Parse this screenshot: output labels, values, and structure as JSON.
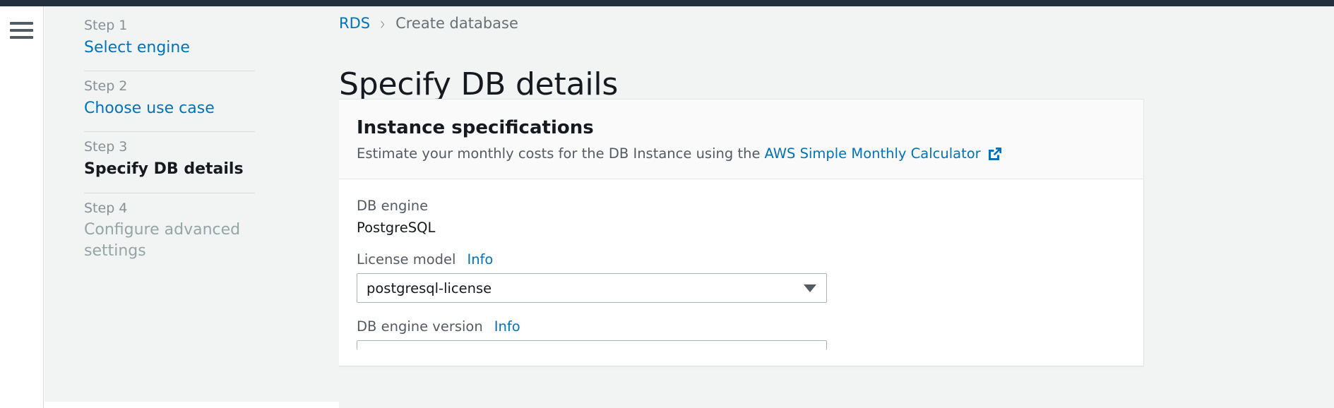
{
  "colors": {
    "topbar": "#232f3e",
    "link": "#0073bb",
    "muted": "#879196",
    "text": "#16191f",
    "panel_bg": "#ffffff",
    "page_bg": "#f2f3f3"
  },
  "nav": {
    "menu_icon": "hamburger-icon"
  },
  "wizard": {
    "steps": [
      {
        "number": "Step 1",
        "title": "Select engine",
        "state": "link"
      },
      {
        "number": "Step 2",
        "title": "Choose use case",
        "state": "link"
      },
      {
        "number": "Step 3",
        "title": "Specify DB details",
        "state": "current"
      },
      {
        "number": "Step 4",
        "title": "Configure advanced settings",
        "state": "disabled"
      }
    ]
  },
  "breadcrumb": {
    "root": "RDS",
    "separator": "›",
    "current": "Create database"
  },
  "page": {
    "title": "Specify DB details"
  },
  "panel": {
    "title": "Instance specifications",
    "description_prefix": "Estimate your monthly costs for the DB Instance using the",
    "link_label": "AWS Simple Monthly Calculator",
    "link_icon": "external-link-icon",
    "fields": {
      "db_engine": {
        "label": "DB engine",
        "value": "PostgreSQL"
      },
      "license_model": {
        "label": "License model",
        "info_label": "Info",
        "value": "postgresql-license",
        "caret_icon": "chevron-down-icon"
      },
      "db_engine_version": {
        "label": "DB engine version",
        "info_label": "Info"
      }
    }
  }
}
